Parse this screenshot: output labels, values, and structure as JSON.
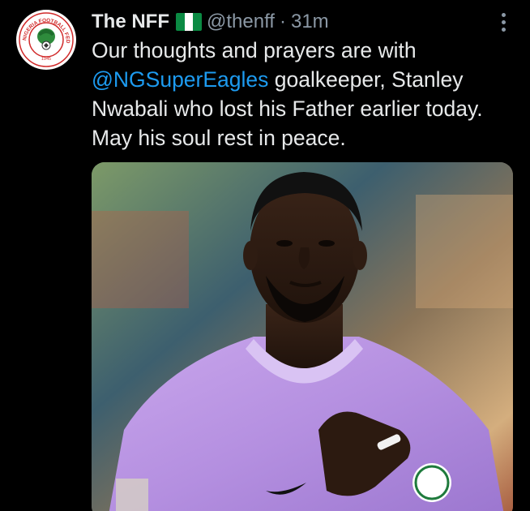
{
  "tweet": {
    "author": {
      "display_name": "The NFF",
      "flag_icon": "nigeria-flag-icon",
      "handle": "@thenff",
      "separator": "·",
      "time": "31m",
      "avatar_icon": "nff-logo-icon",
      "avatar_text": "NIGERIA FOOTBALL FEDERATION",
      "avatar_year": "1945"
    },
    "text_before": "Our thoughts and prayers are with ",
    "mention": "@NGSuperEagles",
    "text_after": " goalkeeper, Stanley Nwabali who lost his Father earlier today. May his soul rest in peace.",
    "more_icon": "more-vertical-icon",
    "media_icon": "photo-image"
  },
  "colors": {
    "background": "#000000",
    "text": "#e7e9ea",
    "muted": "#8b98a5",
    "link": "#1d9bf0"
  }
}
